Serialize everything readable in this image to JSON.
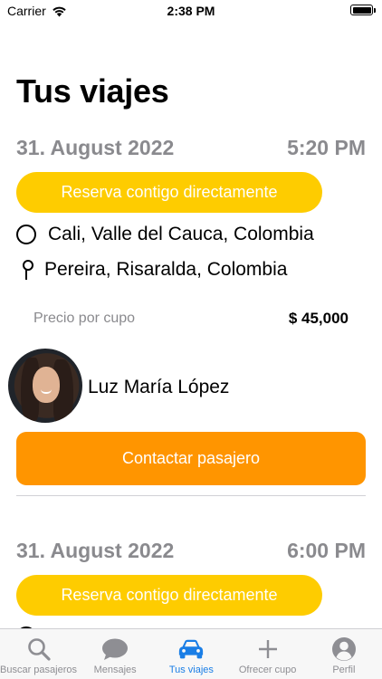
{
  "status_bar": {
    "carrier": "Carrier",
    "time": "2:38 PM",
    "battery_level": 1.0
  },
  "header": {
    "title": "Tus viajes"
  },
  "trips": [
    {
      "date": "31. August 2022",
      "time": "5:20 PM",
      "badge": "Reserva contigo directamente",
      "origin": "Cali, Valle del Cauca, Colombia",
      "destination": "Pereira, Risaralda, Colombia",
      "price_label": "Precio por cupo",
      "price": "$ 45,000",
      "passenger_name": "Luz María López",
      "contact_label": "Contactar pasajero"
    },
    {
      "date": "31. August 2022",
      "time": "6:00 PM",
      "badge": "Reserva contigo directamente"
    }
  ],
  "tabs": [
    {
      "label": "Buscar pasajeros",
      "icon": "search-icon",
      "active": false
    },
    {
      "label": "Mensajes",
      "icon": "chat-bubble-icon",
      "active": false
    },
    {
      "label": "Tus viajes",
      "icon": "car-icon",
      "active": true
    },
    {
      "label": "Ofrecer cupo",
      "icon": "plus-icon",
      "active": false
    },
    {
      "label": "Perfil",
      "icon": "person-icon",
      "active": false
    }
  ],
  "colors": {
    "badge_yellow": "#fecc00",
    "contact_orange": "#ff9500",
    "active_tab_blue": "#1a7ee6",
    "inactive_tab_gray": "#8e8e93",
    "secondary_text": "#8a8a8e"
  }
}
